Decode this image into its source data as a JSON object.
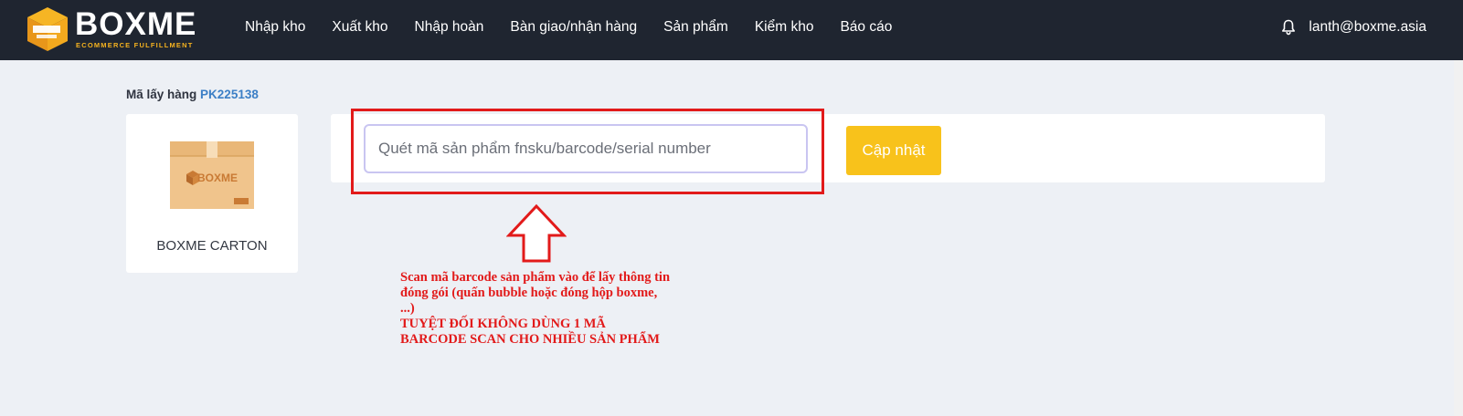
{
  "header": {
    "logo_text": "BOXME",
    "logo_subtext": "ECOMMERCE FULFILLMENT",
    "nav_items": [
      {
        "label": "Nhập kho"
      },
      {
        "label": "Xuất kho"
      },
      {
        "label": "Nhập hoàn"
      },
      {
        "label": "Bàn giao/nhận hàng"
      },
      {
        "label": "Sản phẩm"
      },
      {
        "label": "Kiểm kho"
      },
      {
        "label": "Báo cáo"
      }
    ],
    "user_email": "lanth@boxme.asia",
    "bell_icon": "bell-icon"
  },
  "pickup": {
    "label": "Mã lấy hàng",
    "code": "PK225138"
  },
  "carton": {
    "image_icon": "carton-box-icon",
    "image_brand": "BOXME",
    "name": "BOXME CARTON"
  },
  "scan": {
    "placeholder": "Quét mã sản phẩm fnsku/barcode/serial number",
    "value": "",
    "button_label": "Cập nhật"
  },
  "annotation": {
    "lines": [
      "Scan mã barcode sản phẩm vào để lấy thông tin đóng gói (quấn bubble hoặc đóng hộp boxme, ...)",
      "TUYỆT ĐỐI KHÔNG DÙNG 1 MÃ BARCODE SCAN CHO NHIỀU SẢN PHẨM"
    ],
    "color": "#e21a1a",
    "arrow_icon": "up-arrow-icon"
  },
  "colors": {
    "nav_bg": "#1f2530",
    "page_bg": "#edf0f5",
    "accent_yellow": "#f8c21b",
    "link_blue": "#3c7fc6"
  }
}
